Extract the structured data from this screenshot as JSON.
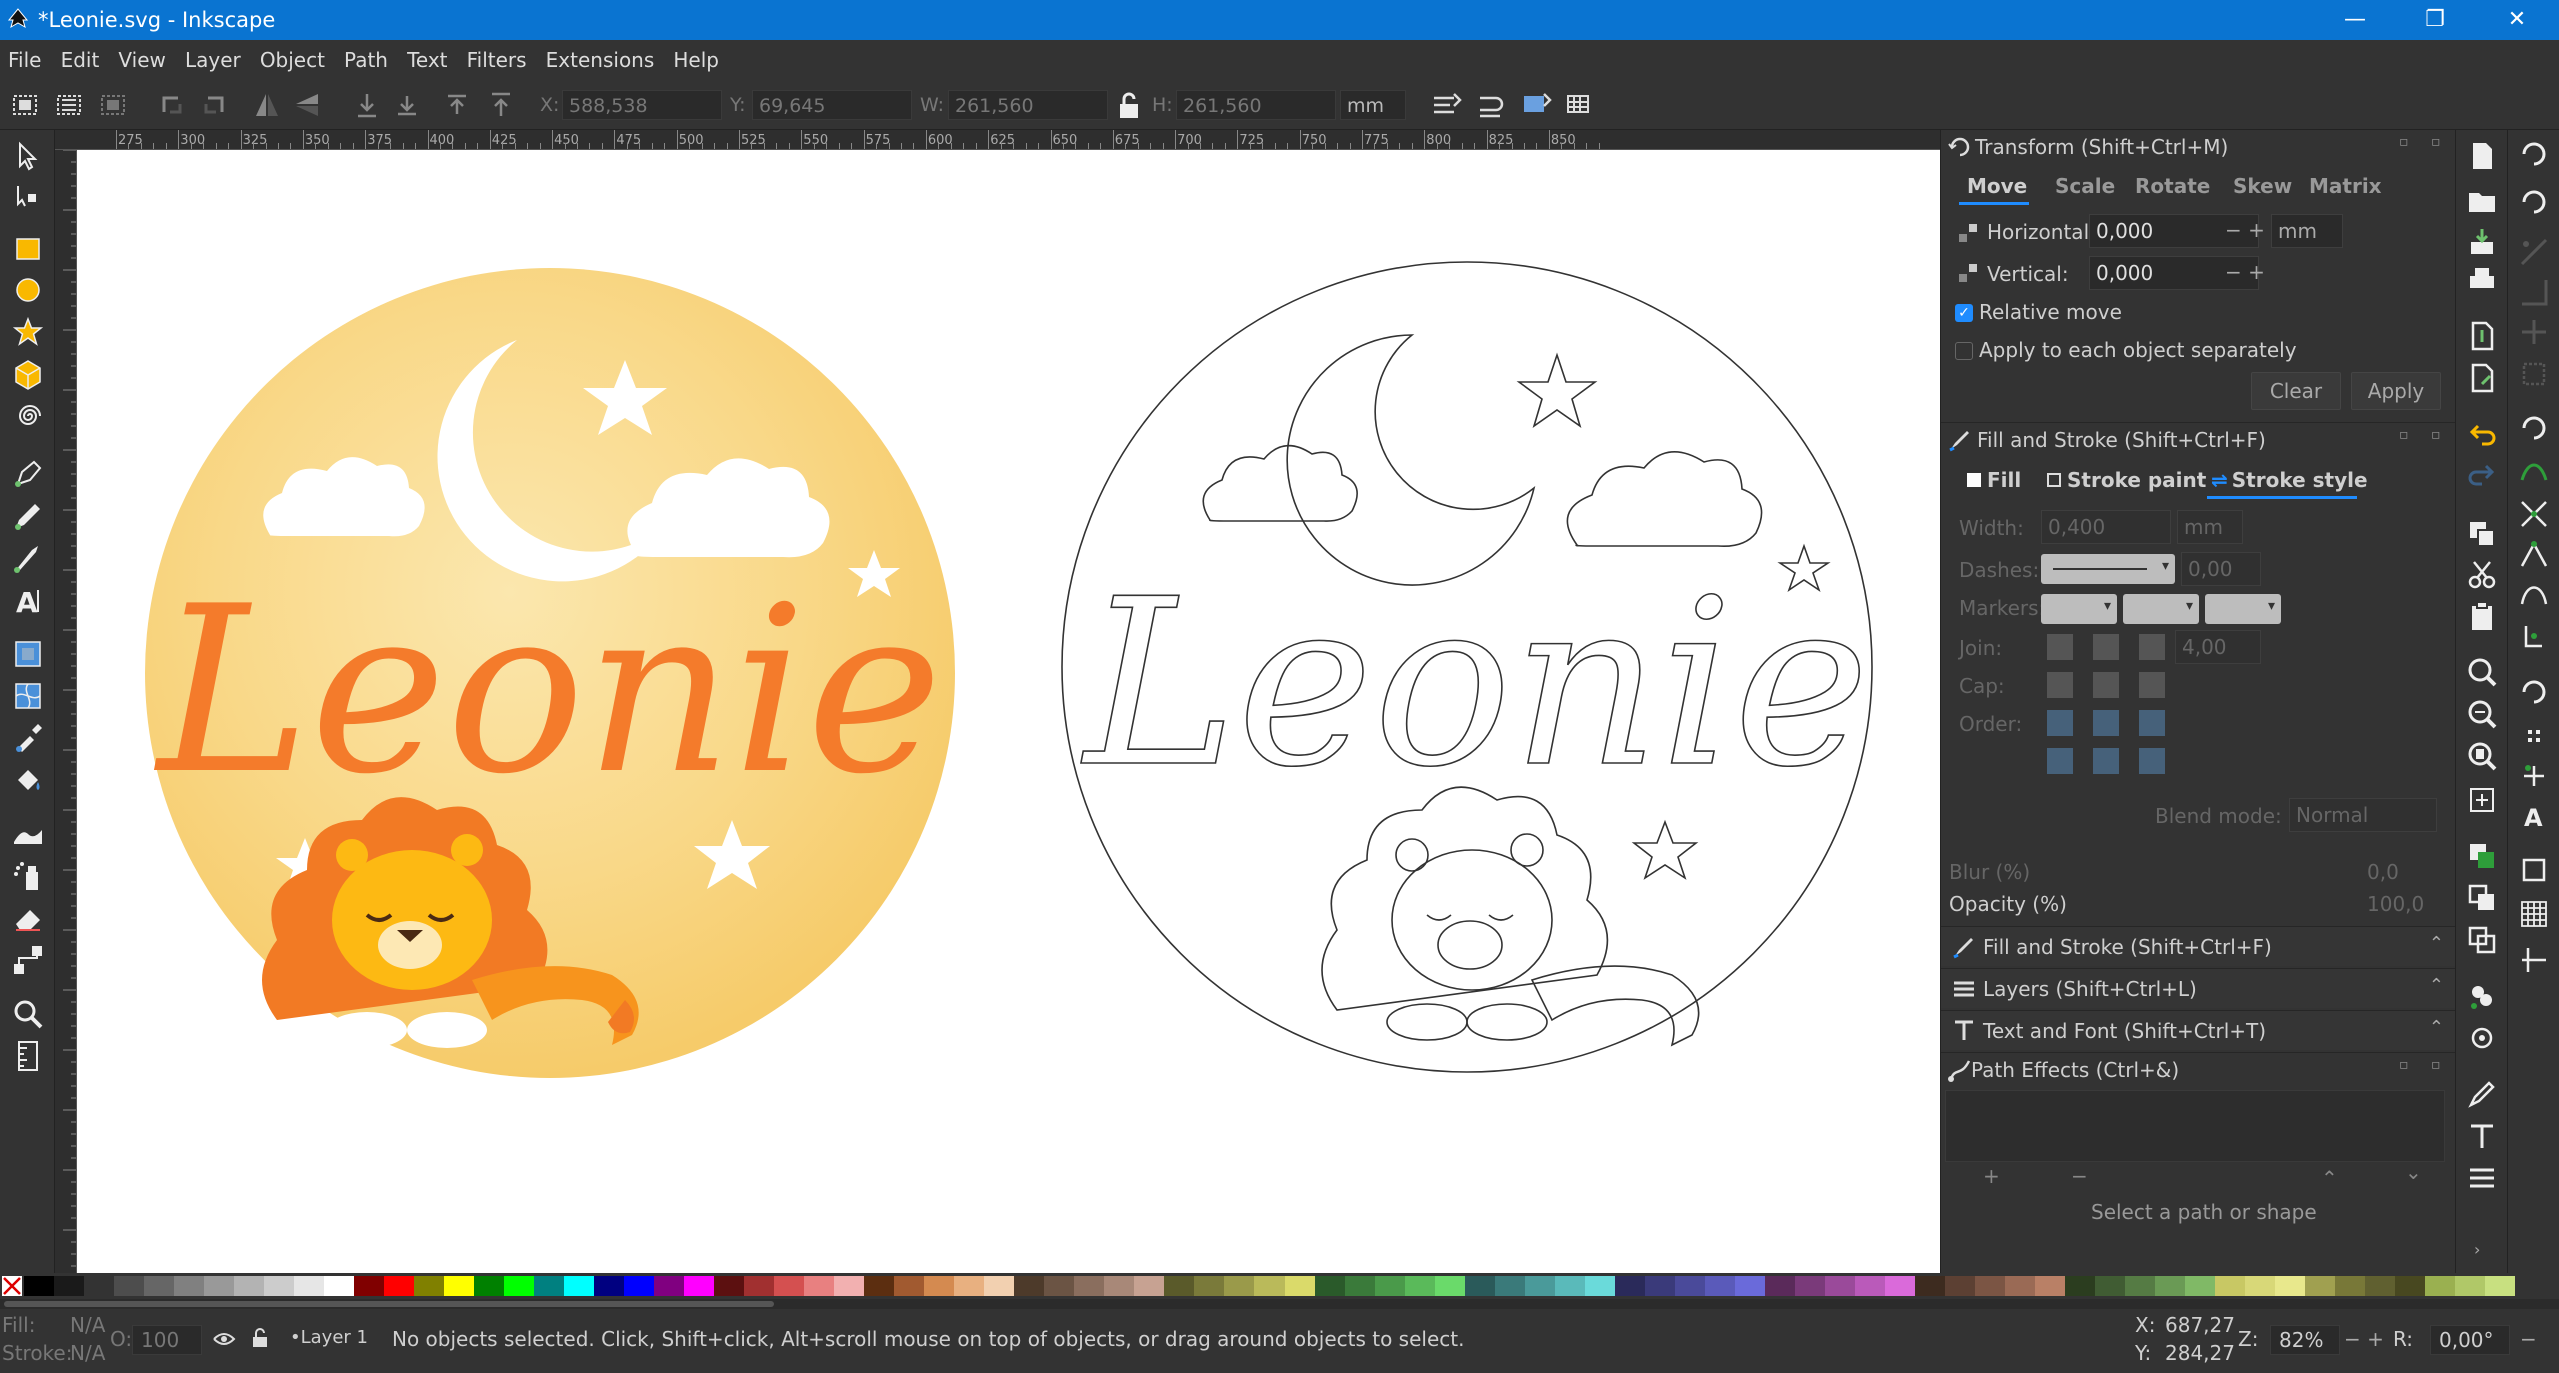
{
  "window": {
    "title": "*Leonie.svg - Inkscape",
    "minimize": "—",
    "maximize": "❐",
    "close": "✕"
  },
  "menu": [
    "File",
    "Edit",
    "View",
    "Layer",
    "Object",
    "Path",
    "Text",
    "Filters",
    "Extensions",
    "Help"
  ],
  "toolbar": {
    "x_label": "X:",
    "x_value": "588,538",
    "y_label": "Y:",
    "y_value": "69,645",
    "w_label": "W:",
    "w_value": "261,560",
    "h_label": "H:",
    "h_value": "261,560",
    "unit": "mm"
  },
  "ruler_top": [
    "275",
    "300",
    "325",
    "350",
    "375",
    "400",
    "425",
    "450",
    "475",
    "500",
    "525",
    "550",
    "575",
    "600",
    "625",
    "650",
    "675",
    "700",
    "725",
    "750",
    "775",
    "800",
    "825",
    "850"
  ],
  "canvas": {
    "left_name": "Leonie",
    "right_name": "Leonie",
    "colors": {
      "wood_light": "#fbe3a0",
      "wood_dark": "#f6c65c",
      "name_orange": "#f47b2b",
      "lion_orange": "#f7941d",
      "lion_yellow": "#fdb913",
      "mane_orange": "#f27a24"
    }
  },
  "transform": {
    "title": "Transform (Shift+Ctrl+M)",
    "tabs": [
      "Move",
      "Scale",
      "Rotate",
      "Skew",
      "Matrix"
    ],
    "horizontal_label": "Horizontal:",
    "horizontal_value": "0,000",
    "vertical_label": "Vertical:",
    "vertical_value": "0,000",
    "unit": "mm",
    "relative_move": "Relative move",
    "apply_each": "Apply to each object separately",
    "clear": "Clear",
    "apply": "Apply"
  },
  "fill_stroke": {
    "title": "Fill and Stroke (Shift+Ctrl+F)",
    "tabs": [
      "Fill",
      "Stroke paint",
      "Stroke style"
    ],
    "width_label": "Width:",
    "width_value": "0,400",
    "width_unit": "mm",
    "dashes_label": "Dashes:",
    "dashes_value": "0,00",
    "markers_label": "Markers:",
    "join_label": "Join:",
    "join_value": "4,00",
    "cap_label": "Cap:",
    "order_label": "Order:",
    "blend_label": "Blend mode:",
    "blend_value": "Normal",
    "blur_label": "Blur (%)",
    "blur_value": "0,0",
    "opacity_label": "Opacity (%)",
    "opacity_value": "100,0"
  },
  "collapsed_panels": [
    {
      "label": "Fill and Stroke (Shift+Ctrl+F)",
      "icon": "brush-icon"
    },
    {
      "label": "Layers (Shift+Ctrl+L)",
      "icon": "layers-icon"
    },
    {
      "label": "Text and Font (Shift+Ctrl+T)",
      "icon": "text-icon"
    }
  ],
  "path_effects": {
    "title": "Path Effects (Ctrl+&)",
    "add": "+",
    "remove": "−",
    "up": "⌃",
    "down": "⌄",
    "hint": "Select a path or shape"
  },
  "status": {
    "fill_label": "Fill:",
    "fill_value": "N/A",
    "stroke_label": "Stroke:",
    "stroke_value": "N/A",
    "opacity_label": "O:",
    "opacity_value": "100",
    "layer": "•Layer 1",
    "message": "No objects selected. Click, Shift+click, Alt+scroll mouse on top of objects, or drag around objects to select.",
    "x_label": "X:",
    "x_value": "687,27",
    "y_label": "Y:",
    "y_value": "284,27",
    "zoom_label": "Z:",
    "zoom_value": "82%",
    "rot_label": "R:",
    "rot_value": "0,00°"
  }
}
